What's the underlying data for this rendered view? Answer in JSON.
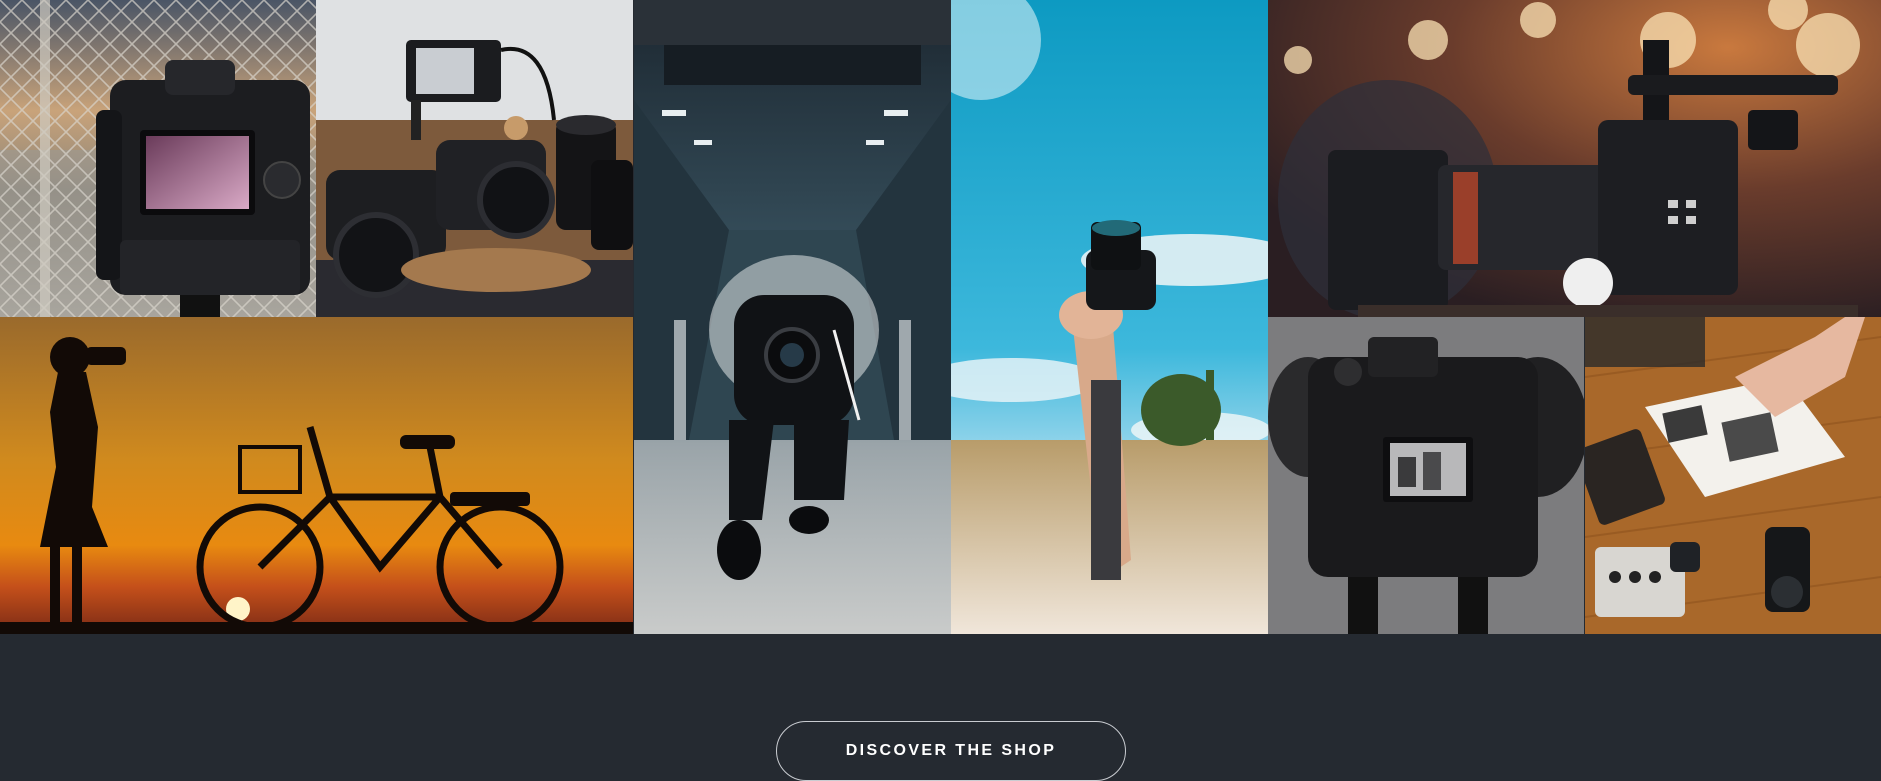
{
  "gallery": {
    "tiles": [
      {
        "name": "dslr-on-tripod-photo",
        "alt": "DSLR camera on tripod behind chain-link fence"
      },
      {
        "name": "camera-gear-on-table-photo",
        "alt": "Camera bodies, lenses and monitor on table"
      },
      {
        "name": "sunset-silhouette-bicycle-photo",
        "alt": "Silhouette of woman with camera and bicycle at sunset"
      },
      {
        "name": "escalator-photographer-photo",
        "alt": "Photographer crouching on escalator with smoke"
      },
      {
        "name": "hand-raising-camera-photo",
        "alt": "Hand holding camera up against blue sky over wheat field"
      },
      {
        "name": "cinema-camera-rig-photo",
        "alt": "Professional cinema camera with bokeh lights"
      },
      {
        "name": "camera-back-screen-photo",
        "alt": "Black and white camera viewing screen"
      },
      {
        "name": "vintage-cameras-book-photo",
        "alt": "Vintage cameras and photo book on wooden table"
      }
    ]
  },
  "footer": {
    "cta_label": "DISCOVER THE SHOP"
  },
  "colors": {
    "footer_bg": "#252a31",
    "button_border": "#c9ccd1"
  }
}
